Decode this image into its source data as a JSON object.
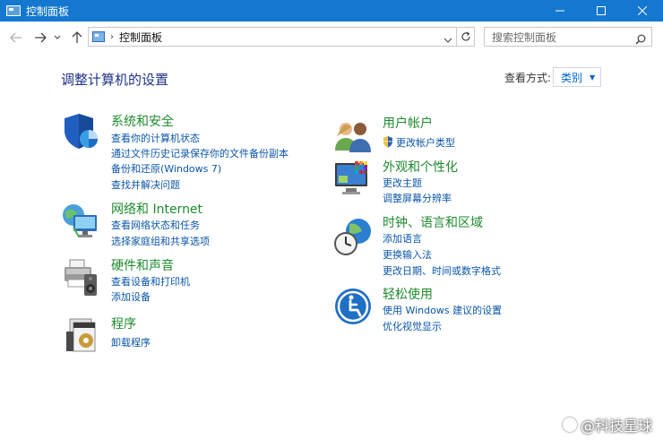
{
  "window": {
    "title": "控制面板",
    "controls": {
      "minimize": "minimize-icon",
      "maximize": "maximize-icon",
      "close": "close-icon"
    }
  },
  "address_bar": {
    "path": "控制面板",
    "separator": "›"
  },
  "search": {
    "placeholder": "搜索控制面板"
  },
  "main": {
    "title": "调整计算机的设置",
    "view_by_label": "查看方式:",
    "view_by_value": "类别"
  },
  "categories": [
    {
      "title": "系统和安全",
      "icon": "system-security-icon",
      "links": [
        "查看你的计算机状态",
        "通过文件历史记录保存你的文件备份副本",
        "备份和还原(Windows 7)",
        "查找并解决问题"
      ]
    },
    {
      "title": "网络和 Internet",
      "icon": "network-internet-icon",
      "links": [
        "查看网络状态和任务",
        "选择家庭组和共享选项"
      ]
    },
    {
      "title": "硬件和声音",
      "icon": "hardware-sound-icon",
      "links": [
        "查看设备和打印机",
        "添加设备"
      ]
    },
    {
      "title": "程序",
      "icon": "programs-icon",
      "links": [
        "卸载程序"
      ]
    },
    {
      "title": "用户帐户",
      "icon": "user-accounts-icon",
      "links": [
        "更改帐户类型"
      ]
    },
    {
      "title": "外观和个性化",
      "icon": "appearance-icon",
      "links": [
        "更改主题",
        "调整屏幕分辨率"
      ]
    },
    {
      "title": "时钟、语言和区域",
      "icon": "clock-region-icon",
      "links": [
        "添加语言",
        "更换输入法",
        "更改日期、时间或数字格式"
      ]
    },
    {
      "title": "轻松使用",
      "icon": "ease-of-access-icon",
      "links": [
        "使用 Windows 建议的设置",
        "优化视觉显示"
      ]
    }
  ],
  "watermark": "@科技星球",
  "colors": {
    "titlebar": "#1478d0",
    "category_title": "#1e8a2e",
    "link": "#0b56a8",
    "page_title": "#1e3287"
  }
}
